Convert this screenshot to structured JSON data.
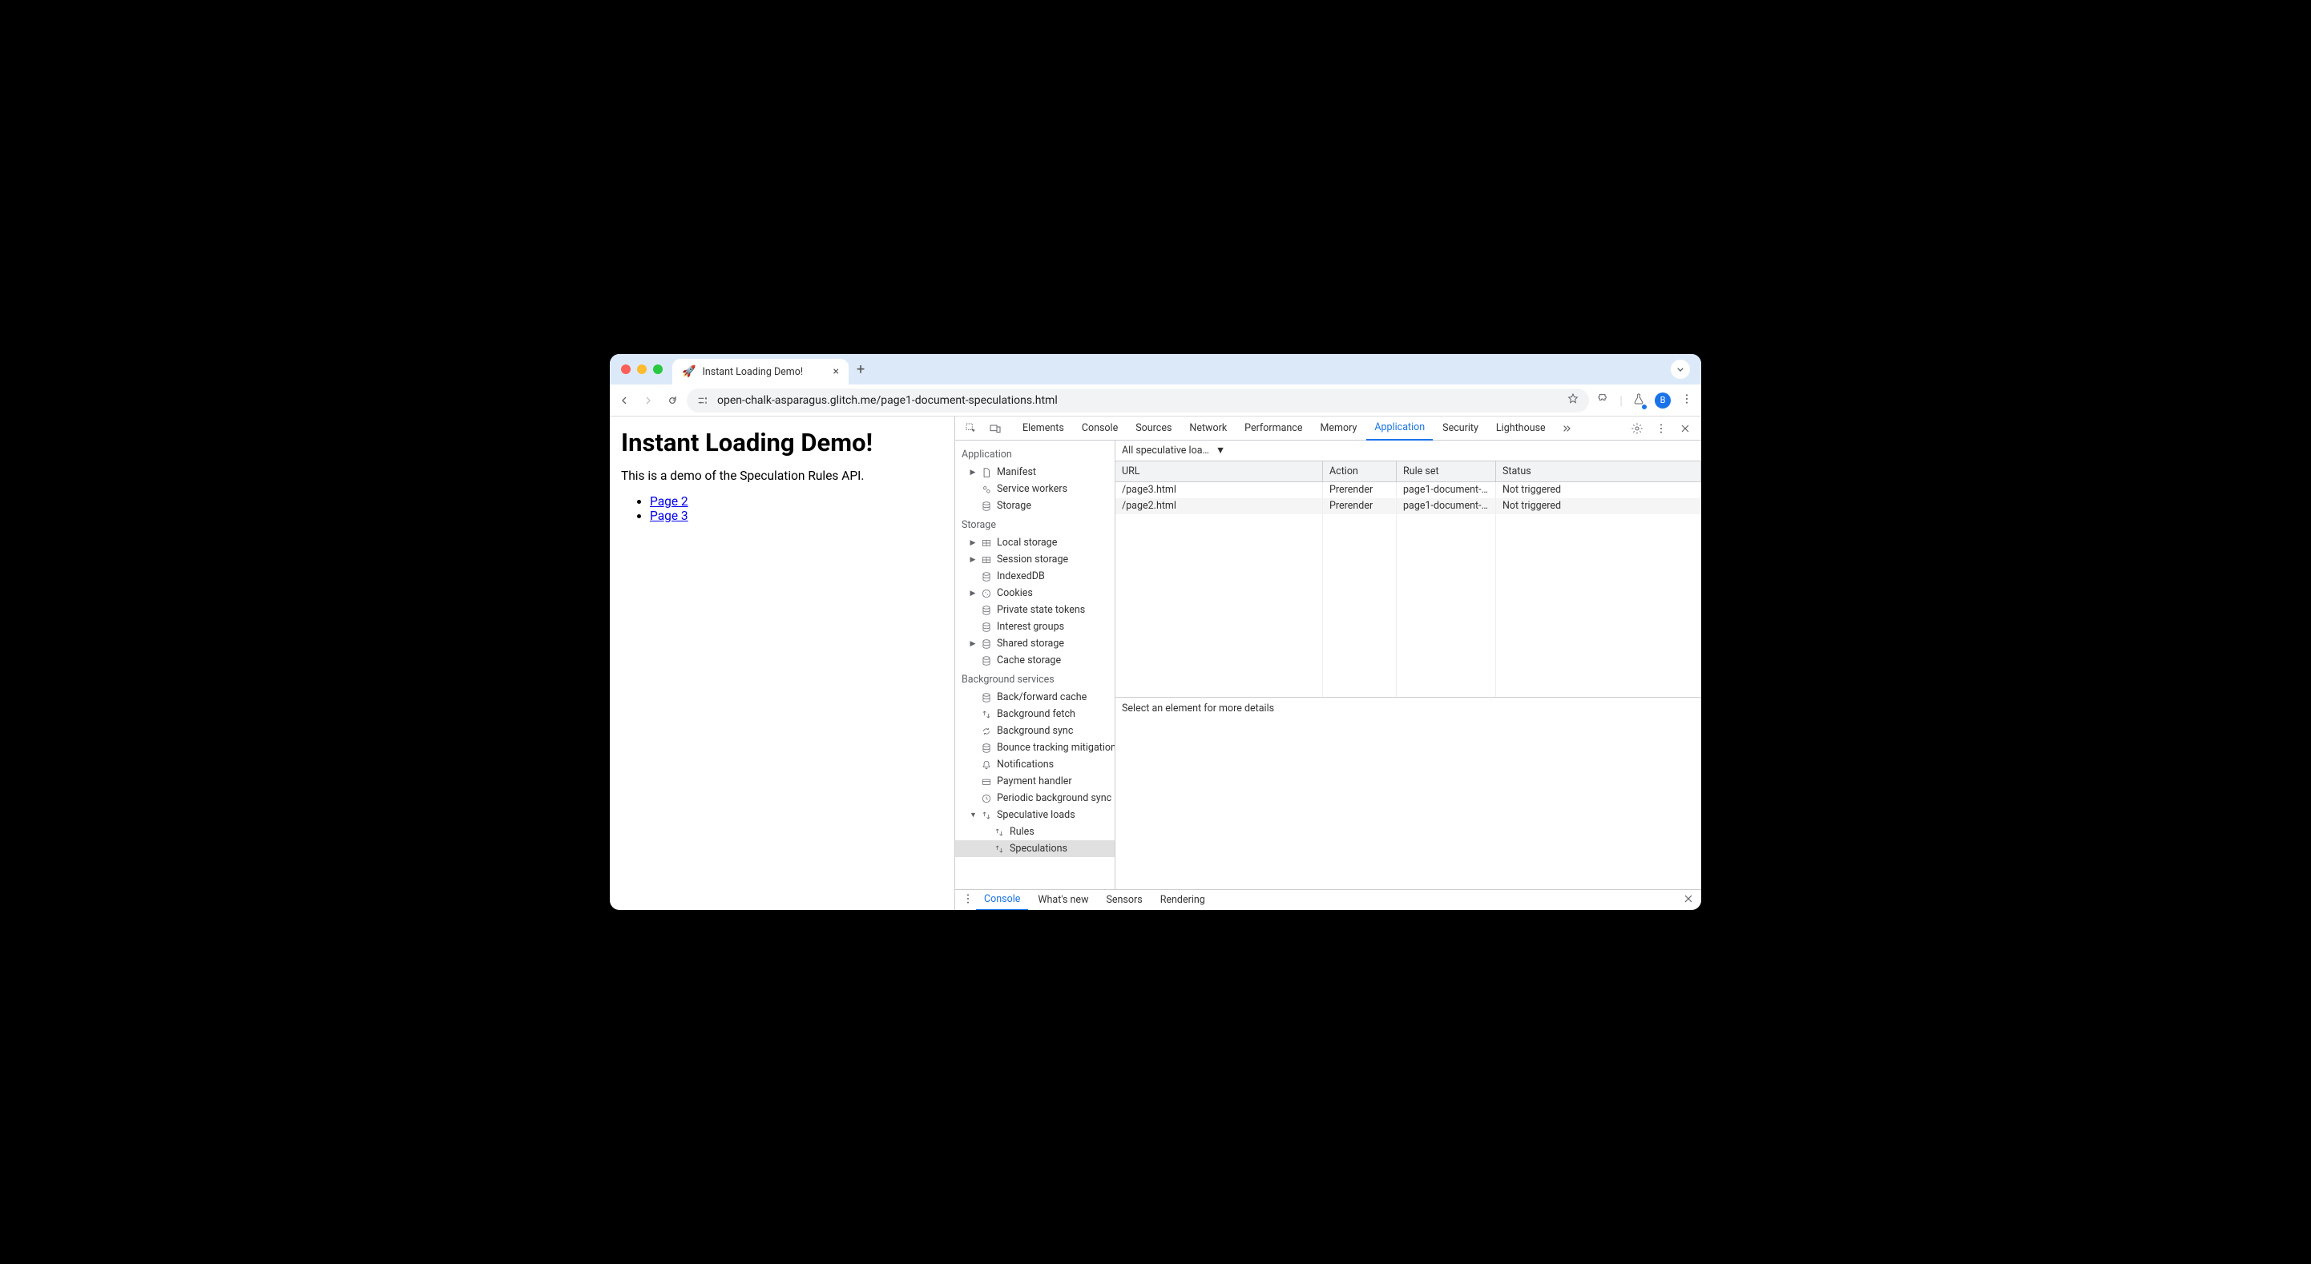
{
  "tab": {
    "title": "Instant Loading Demo!",
    "favicon": "🚀"
  },
  "url": "open-chalk-asparagus.glitch.me/page1-document-speculations.html",
  "avatar_letter": "B",
  "page": {
    "heading": "Instant Loading Demo!",
    "intro": "This is a demo of the Speculation Rules API.",
    "links": [
      "Page 2",
      "Page 3"
    ]
  },
  "devtools": {
    "tabs": [
      "Elements",
      "Console",
      "Sources",
      "Network",
      "Performance",
      "Memory",
      "Application",
      "Security",
      "Lighthouse"
    ],
    "active_tab": "Application",
    "sidebar": {
      "sections": [
        {
          "title": "Application",
          "items": [
            {
              "label": "Manifest",
              "icon": "file",
              "arrow": "right"
            },
            {
              "label": "Service workers",
              "icon": "gears"
            },
            {
              "label": "Storage",
              "icon": "db"
            }
          ]
        },
        {
          "title": "Storage",
          "items": [
            {
              "label": "Local storage",
              "icon": "grid",
              "arrow": "right"
            },
            {
              "label": "Session storage",
              "icon": "grid",
              "arrow": "right"
            },
            {
              "label": "IndexedDB",
              "icon": "db"
            },
            {
              "label": "Cookies",
              "icon": "cookie",
              "arrow": "right"
            },
            {
              "label": "Private state tokens",
              "icon": "db"
            },
            {
              "label": "Interest groups",
              "icon": "db"
            },
            {
              "label": "Shared storage",
              "icon": "db",
              "arrow": "right"
            },
            {
              "label": "Cache storage",
              "icon": "db"
            }
          ]
        },
        {
          "title": "Background services",
          "items": [
            {
              "label": "Back/forward cache",
              "icon": "db"
            },
            {
              "label": "Background fetch",
              "icon": "updown"
            },
            {
              "label": "Background sync",
              "icon": "sync"
            },
            {
              "label": "Bounce tracking mitigation",
              "icon": "db"
            },
            {
              "label": "Notifications",
              "icon": "bell"
            },
            {
              "label": "Payment handler",
              "icon": "card"
            },
            {
              "label": "Periodic background sync",
              "icon": "clock"
            },
            {
              "label": "Speculative loads",
              "icon": "updown",
              "arrow": "down",
              "children": [
                {
                  "label": "Rules",
                  "icon": "updown"
                },
                {
                  "label": "Speculations",
                  "icon": "updown",
                  "selected": true
                }
              ]
            }
          ]
        }
      ]
    },
    "filter_label": "All speculative loa…",
    "table": {
      "headers": [
        "URL",
        "Action",
        "Rule set",
        "Status"
      ],
      "rows": [
        {
          "url": "/page3.html",
          "action": "Prerender",
          "ruleset": "page1-document-…",
          "status": "Not triggered"
        },
        {
          "url": "/page2.html",
          "action": "Prerender",
          "ruleset": "page1-document-…",
          "status": "Not triggered"
        }
      ]
    },
    "details_hint": "Select an element for more details",
    "drawer_tabs": [
      "Console",
      "What's new",
      "Sensors",
      "Rendering"
    ],
    "drawer_active": "Console"
  }
}
